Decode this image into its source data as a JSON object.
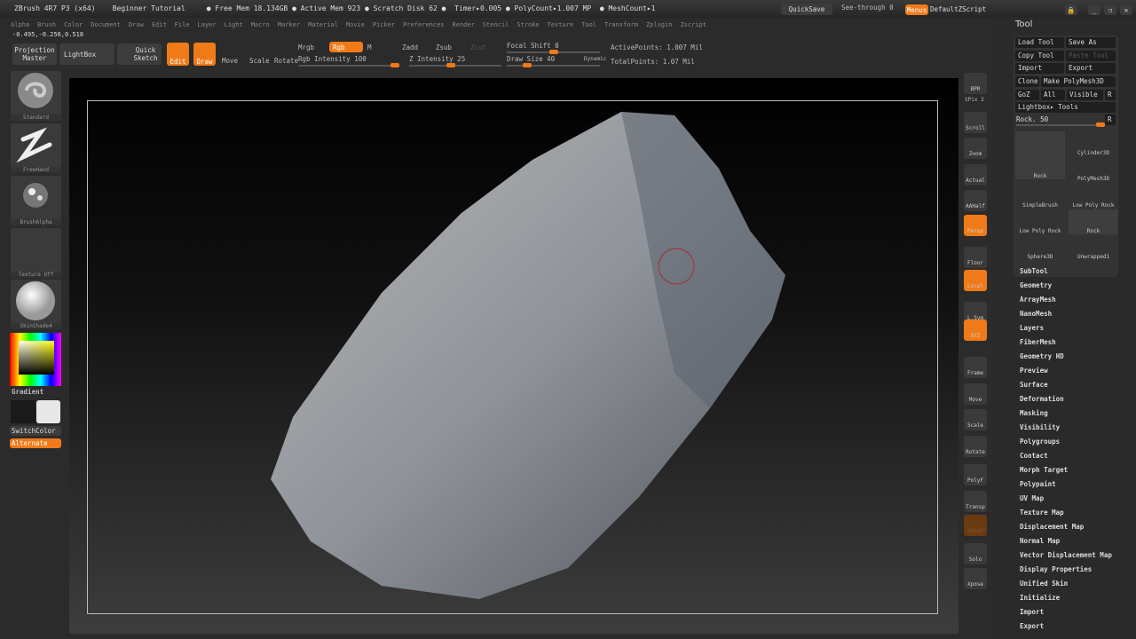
{
  "title": "ZBrush 4R7 P3 (x64)    Beginner Tutorial     ● Free Mem 18.134GB ● Active Mem 923 ● Scratch Disk 62 ●  Timer▸0.005 ● PolyCount▸1.007 MP  ● MeshCount▸1",
  "topright": {
    "quicksave": "QuickSave",
    "seethrough": "See-through  0",
    "menus": "Menus",
    "script": "DefaultZScript"
  },
  "menus": [
    "Alpha",
    "Brush",
    "Color",
    "Document",
    "Draw",
    "Edit",
    "File",
    "Layer",
    "Light",
    "Macro",
    "Marker",
    "Material",
    "Movie",
    "Picker",
    "Preferences",
    "Render",
    "Stencil",
    "Stroke",
    "Texture",
    "Tool",
    "Transform",
    "Zplugin",
    "Zscript"
  ],
  "coords": "-0.495,-0.256,0.518",
  "toolbar": {
    "projection_master": "Projection Master",
    "lightbox": "LightBox",
    "quick_sketch": "Quick Sketch",
    "edit": "Edit",
    "draw": "Draw",
    "move": "Move",
    "scale": "Scale",
    "rotate": "Rotate",
    "mrgb": "Mrgb",
    "rgb": "Rgb",
    "m": "M",
    "zadd": "Zadd",
    "zsub": "Zsub",
    "zcut": "Zcut",
    "rgb_intensity": "Rgb Intensity 100",
    "z_intensity": "Z Intensity 25",
    "focal_shift": "Focal Shift 0",
    "draw_size": "Draw Size 40",
    "dynamic": "Dynamic",
    "active_points": "ActivePoints: 1.007 Mil",
    "total_points": "TotalPoints: 1.07 Mil"
  },
  "left": {
    "brush": "Standard",
    "stroke": "FreeHand",
    "alpha": "BrushAlpha",
    "texture": "Texture Off",
    "material": "SkinShade4",
    "gradient": "Gradient",
    "switchcolor": "SwitchColor",
    "alternate": "Alternate"
  },
  "shelf": [
    "BPR",
    "SPix 3",
    "Scroll",
    "Zoom",
    "Actual",
    "AAHalf",
    "Persp",
    "Floor",
    "Local",
    "L.Sym",
    "XYZ",
    "Frame",
    "Move",
    "Scale",
    "Rotate",
    "PolyF",
    "Transp",
    "Ghost",
    "Solo",
    "Xpose"
  ],
  "tool": {
    "title": "Tool",
    "load": "Load Tool",
    "save_as": "Save As",
    "copy": "Copy Tool",
    "paste": "Paste Tool",
    "import": "Import",
    "export": "Export",
    "clone": "Clone",
    "make_polymesh": "Make PolyMesh3D",
    "goz": "GoZ",
    "all": "All",
    "visible": "Visible",
    "r": "R",
    "lightbox_tools": "Lightbox▸ Tools",
    "rock_slider": "Rock. 50",
    "thumbs": [
      "Rock",
      "Cylinder3D",
      "PolyMesh3D",
      "SimpleBrush",
      "Low Poly Rock",
      "Low Poly Rock",
      "Rock",
      "Sphere3D",
      "Unwrapped1"
    ],
    "sections": [
      "SubTool",
      "Geometry",
      "ArrayMesh",
      "NanoMesh",
      "Layers",
      "FiberMesh",
      "Geometry HD",
      "Preview",
      "Surface",
      "Deformation",
      "Masking",
      "Visibility",
      "Polygroups",
      "Contact",
      "Morph Target",
      "Polypaint",
      "UV Map",
      "Texture Map",
      "Displacement Map",
      "Normal Map",
      "Vector Displacement Map",
      "Display Properties",
      "Unified Skin",
      "Initialize",
      "Import",
      "Export"
    ]
  },
  "colors": {
    "accent": "#f07a18"
  }
}
